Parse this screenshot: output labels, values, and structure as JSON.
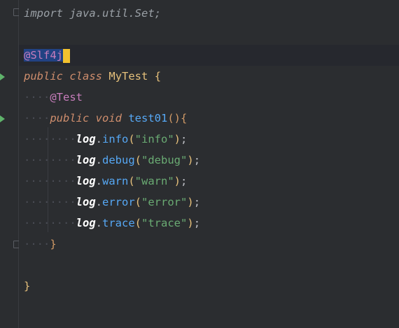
{
  "editor": {
    "lines": {
      "l0": {
        "kw": "import",
        "text": " java.util.",
        "cls": "Set",
        "end": ";"
      },
      "l2": {
        "ann_sel": "@Slf4j"
      },
      "l3": {
        "kw1": "public",
        "kw2": "class",
        "name": "MyTest",
        "brace": "{"
      },
      "l4": {
        "ann": "@Test"
      },
      "l5": {
        "kw1": "public",
        "kw2": "void",
        "fn": "test01",
        "paren": "()",
        "brace": "{"
      },
      "l6": {
        "var": "log",
        "method": "info",
        "arg": "\"info\""
      },
      "l7": {
        "var": "log",
        "method": "debug",
        "arg": "\"debug\""
      },
      "l8": {
        "var": "log",
        "method": "warn",
        "arg": "\"warn\""
      },
      "l9": {
        "var": "log",
        "method": "error",
        "arg": "\"error\""
      },
      "l10": {
        "var": "log",
        "method": "trace",
        "arg": "\"trace\""
      },
      "l11": {
        "brace": "}"
      },
      "l13": {
        "brace": "}"
      }
    },
    "colors": {
      "background": "#2b2d30",
      "keyword": "#cf8e6d",
      "string": "#6aab73",
      "method": "#56a8f5",
      "annotation": "#c77dbb",
      "cursor": "#f2c12e"
    }
  }
}
